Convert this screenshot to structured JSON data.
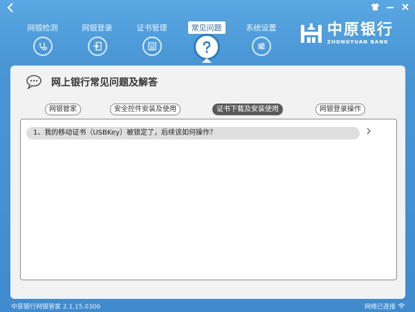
{
  "titlebar": {
    "back_icon": "back-arrow-icon",
    "controls": [
      "shirt-icon",
      "minimize-icon",
      "close-icon"
    ]
  },
  "nav": {
    "items": [
      {
        "label": "网银检测",
        "icon": "stethoscope-icon"
      },
      {
        "label": "网银登录",
        "icon": "login-icon"
      },
      {
        "label": "证书管理",
        "icon": "certificate-icon"
      },
      {
        "label": "常见问题",
        "icon": "question-icon",
        "active": true
      },
      {
        "label": "系统设置",
        "icon": "settings-sliders-icon"
      }
    ]
  },
  "logo": {
    "cn": "中原银行",
    "en": "ZHONGYUAN BANK"
  },
  "panel": {
    "title": "网上银行常见问题及解答",
    "tabs": [
      {
        "label": "网银管家"
      },
      {
        "label": "安全控件安装及使用"
      },
      {
        "label": "证书下载及安装使用",
        "active": true
      },
      {
        "label": "网银登录操作"
      }
    ],
    "faq": [
      {
        "text": "1、我的移动证书（USBKey）被锁定了，后续该如何操作？"
      }
    ]
  },
  "status": {
    "version": "中原银行网银管家 2.1.15.0306",
    "network": "网络已连接"
  },
  "colors": {
    "background": "#4a96d5",
    "active_tab": "#5a5a5a",
    "panel": "#f2f2f2"
  }
}
